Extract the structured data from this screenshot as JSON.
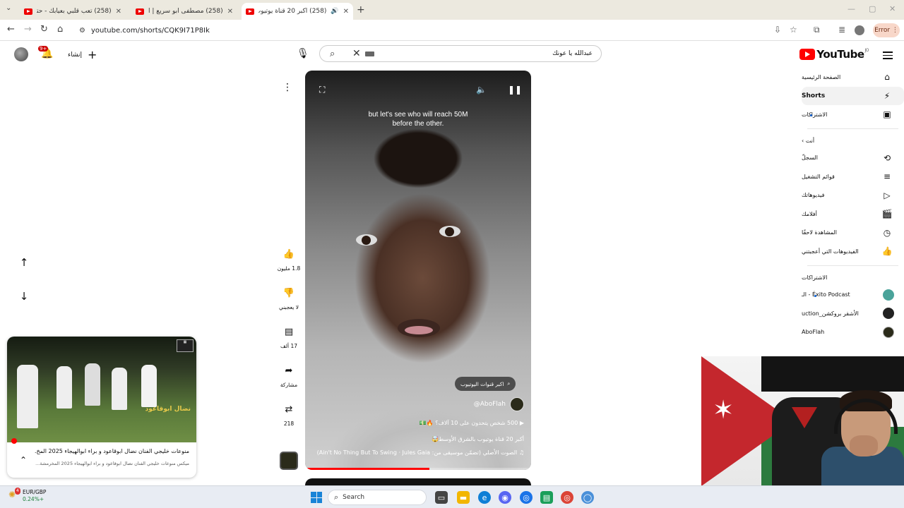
{
  "browser": {
    "tabs": [
      {
        "title": "(258) تعب قلبي بعيابك - حتى ال",
        "active": false
      },
      {
        "title": "(258) مصطفى أبو سريع | أغنية",
        "active": false
      },
      {
        "title": "(258) أكبر 20 قناة يوتيوب بال",
        "active": true
      }
    ],
    "url": "youtube.com/shorts/CQK9I71P8Ik",
    "error_label": "Error"
  },
  "header": {
    "logo_text": "YouTube",
    "logo_country": "JO",
    "search_query": "عبدالله يا عونك",
    "create_label": "إنشاء",
    "notif_count": "9+"
  },
  "sidebar": {
    "items": [
      {
        "label": "الصفحة الرئيسية",
        "icon": "home-icon",
        "glyph": "⌂"
      },
      {
        "label": "Shorts",
        "icon": "shorts-icon",
        "glyph": "⚡"
      },
      {
        "label": "الاشتراكات",
        "icon": "subscriptions-icon",
        "glyph": "▣"
      }
    ],
    "you_label": "أنت",
    "you_items": [
      {
        "label": "السجلّ",
        "icon": "history-icon",
        "glyph": "⟲"
      },
      {
        "label": "قوائم التشغيل",
        "icon": "playlists-icon",
        "glyph": "≡"
      },
      {
        "label": "فيديوهاتك",
        "icon": "your-videos-icon",
        "glyph": "▷"
      },
      {
        "label": "أفلامك",
        "icon": "movies-icon",
        "glyph": "🎬"
      },
      {
        "label": "المشاهدة لاحقًا",
        "icon": "watch-later-icon",
        "glyph": "◷"
      },
      {
        "label": "الفيديوهات التي أعجبتني",
        "icon": "liked-icon",
        "glyph": "👍"
      }
    ],
    "subs_label": "الاشتراكات",
    "subs": [
      {
        "label": "Éxito Podcast - الـ",
        "color": "#4aa39a"
      },
      {
        "label": "الأشقر بروكشن_uction",
        "color": "#222222"
      },
      {
        "label": "AboFlah",
        "color": "#2b2b1a"
      }
    ]
  },
  "short": {
    "caption_line1": "but let's see who will reach 50M",
    "caption_line2": "before the other.",
    "search_chip": "اكبر قنوات اليوتيوب",
    "channel": "@AboFlah",
    "desc_line1": "500 شخص يتحدون على 10 آلاف؟ 🔥💵",
    "desc_line2": "أكبر 20 قناة يوتيوب بالشرق الأوسط🤯",
    "sound_line": "الصوت الأصلي (تضمّن موسيقى من: Ain't No Thing But To Swing · Jules Gaia)",
    "progress": 0.55
  },
  "actions": {
    "likes": "1.8 مليون",
    "dislike_label": "لا يعجبني",
    "comments": "17 ألف",
    "share_label": "مشاركة",
    "remix_count": "218"
  },
  "miniplayer": {
    "title": "منوعات خليجي الفنان نضال ابوقاعود و براء ابوالهيجاء 2025 المخ...",
    "subtitle": "ميكس منوعات خليجي الفنان نضال ابوقاعود و براء ابوالهيجاء 2025 المخرمشة...",
    "overlay": "نضال ابوقاعود"
  },
  "taskbar": {
    "ticker": "EUR/GBP",
    "ticker_change": "0.24%+",
    "weather_badge": "4",
    "search_label": "Search"
  }
}
